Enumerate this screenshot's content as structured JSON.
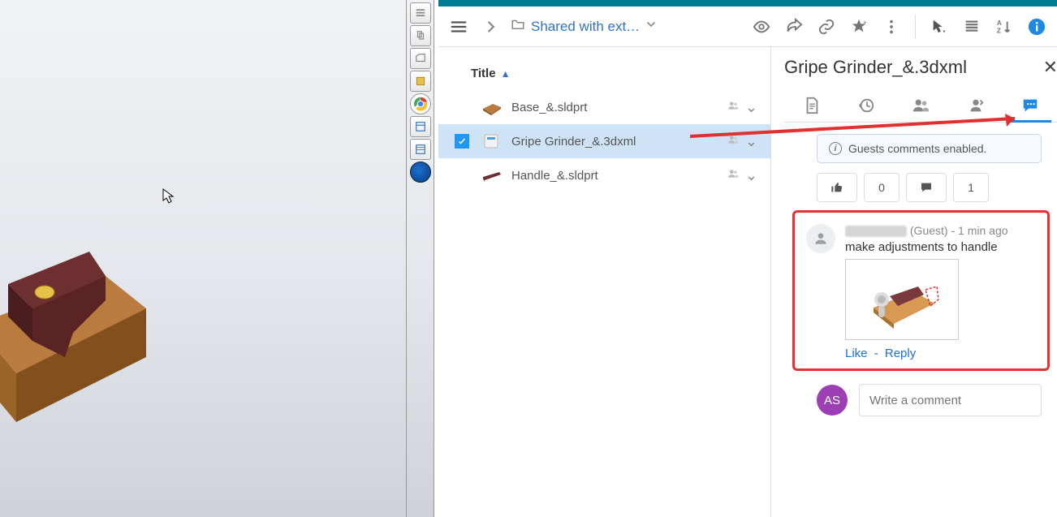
{
  "breadcrumb_label": "Shared with ext…",
  "list_header": "Title",
  "files": [
    {
      "name": "Base_&.sldprt"
    },
    {
      "name": "Gripe Grinder_&.3dxml"
    },
    {
      "name": "Handle_&.sldprt"
    }
  ],
  "detail_title": "Gripe Grinder_&.3dxml",
  "guest_banner": "Guests comments enabled.",
  "stats": {
    "likes": "0",
    "comments": "1"
  },
  "comment": {
    "badge": "(Guest)",
    "time": "1 min ago",
    "sep": " - ",
    "text": "make adjustments to handle",
    "like": "Like",
    "reply": "Reply",
    "dash": "-"
  },
  "write": {
    "avatar": "AS",
    "placeholder": "Write a comment"
  }
}
